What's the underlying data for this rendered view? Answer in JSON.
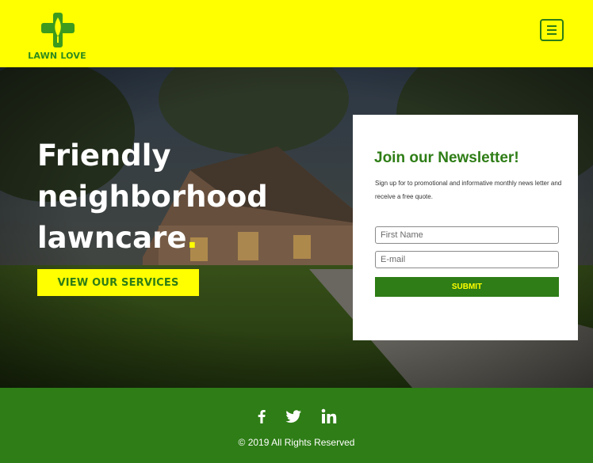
{
  "header": {
    "logo_text": "LAWN LOVE",
    "logo_icon": "leaf-cross-logo",
    "menu_icon": "hamburger-menu-icon",
    "background_color": "#ffff00",
    "brand_color": "#2e7d16"
  },
  "hero": {
    "title_line1": "Friendly",
    "title_line2": "neighborhood",
    "title_line3": "lawncare",
    "title_dot": ".",
    "cta_label": "VIEW OUR SERVICES"
  },
  "newsletter": {
    "title": "Join our Newsletter!",
    "description": "Sign up for to promotional and informative monthly news letter and receive a free quote.",
    "first_name_placeholder": "First Name",
    "email_placeholder": "E-mail",
    "submit_label": "SUBMIT"
  },
  "footer": {
    "social": [
      {
        "name": "facebook-icon"
      },
      {
        "name": "twitter-icon"
      },
      {
        "name": "linkedin-icon"
      }
    ],
    "copyright": "© 2019 All Rights Reserved"
  }
}
